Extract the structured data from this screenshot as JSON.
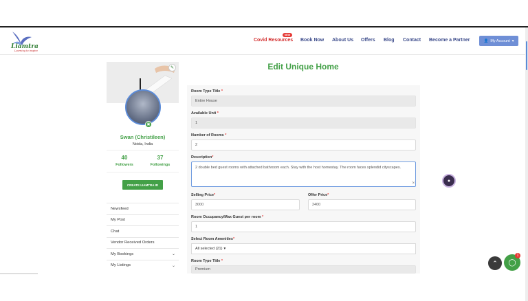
{
  "brand": {
    "name": "Liamtra",
    "tagline": "Learning to inspire"
  },
  "nav": {
    "items": [
      "Covid Resources",
      "Book Now",
      "About Us",
      "Offers",
      "Blog",
      "Contact",
      "Become a Partner"
    ],
    "new_badge": "NEW",
    "account_label": "My Account"
  },
  "profile": {
    "name": "Swan (Christileen)",
    "location": "Noida, India",
    "followers_count": "40",
    "followers_label": "Followers",
    "followings_count": "37",
    "followings_label": "Followings",
    "create_button": "CREATE LIAMTRA ID"
  },
  "sidebar_menu": [
    {
      "label": "Newsfeed",
      "expandable": false
    },
    {
      "label": "My Post",
      "expandable": false
    },
    {
      "label": "Chat",
      "expandable": false
    },
    {
      "label": "Vendor Received Orders",
      "expandable": false
    },
    {
      "label": "My Bookings",
      "expandable": true
    },
    {
      "label": "My Listings",
      "expandable": true
    }
  ],
  "page": {
    "title": "Edit Unique Home"
  },
  "form": {
    "room_type_title_label": "Room Type Title",
    "room_type_title_value": "Entire House",
    "available_unit_label": "Available Unit",
    "available_unit_value": "1",
    "number_of_rooms_label": "Number of Rooms",
    "number_of_rooms_value": "2",
    "description_label": "Description",
    "description_value": "2 double bed guest rooms with attached bathroom each. Stay with the host homestay. The room faces splendid cityscapes.",
    "selling_price_label": "Selling Price",
    "selling_price_value": "3000",
    "offer_price_label": "Offer Price",
    "offer_price_value": "2400",
    "room_occupancy_label": "Room Occupancy/Max Guest per room",
    "room_occupancy_value": "1",
    "amenities_label": "Select Room Amenities",
    "amenities_value": "All selected (21)",
    "room_type_title_2_label": "Room Type Title",
    "room_type_title_2_value": "Premium",
    "required_mark": "*"
  },
  "chat": {
    "unread_count": "1"
  },
  "colors": {
    "brand_green": "#43a047",
    "nav_blue": "#3b4a8a",
    "covid_red": "#d32f2f",
    "account_blue": "#6f8fd6"
  }
}
